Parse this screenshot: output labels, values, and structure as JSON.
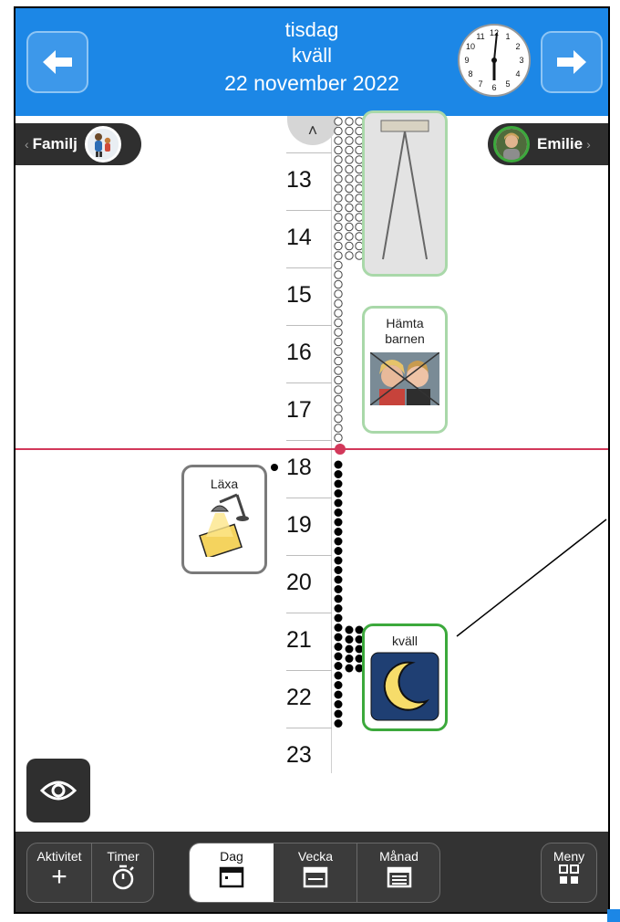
{
  "header": {
    "day": "tisdag",
    "period": "kväll",
    "date": "22 november 2022",
    "prev_label": "previous-day",
    "next_label": "next-day",
    "accent": "#1c87e6"
  },
  "clock": {
    "numbers": [
      "12",
      "1",
      "2",
      "3",
      "4",
      "5",
      "6",
      "7",
      "8",
      "9",
      "10",
      "11"
    ]
  },
  "persons": {
    "left": {
      "name": "Familj"
    },
    "right": {
      "name": "Emilie"
    }
  },
  "timeline": {
    "hours": [
      "13",
      "14",
      "15",
      "16",
      "17",
      "18",
      "19",
      "20",
      "21",
      "22",
      "23"
    ],
    "now_color": "#d2385a"
  },
  "activities": [
    {
      "title": "Hämta barnen"
    },
    {
      "title": "Läxa"
    },
    {
      "title": "kväll"
    }
  ],
  "bottom": {
    "aktivitet": "Aktivitet",
    "timer": "Timer",
    "dag": "Dag",
    "vecka": "Vecka",
    "manad": "Månad",
    "meny": "Meny"
  }
}
